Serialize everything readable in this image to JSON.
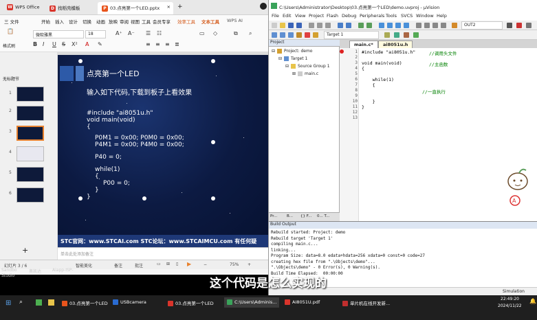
{
  "wps": {
    "tabs": [
      {
        "label": "WPS Office",
        "color": "#d9342b"
      },
      {
        "label": "找稻壳模板",
        "color": "#d9342b"
      },
      {
        "label": "03.点亮第一个LED.pptx",
        "color": "#e8541c"
      }
    ],
    "menu": [
      "三 文件",
      "开始",
      "插入",
      "设计",
      "切换",
      "动画",
      "放映",
      "审阅",
      "视图",
      "工具",
      "会员专享",
      "效率工具",
      "文本工具",
      "WPS AI"
    ],
    "font_name": "微软雅黑",
    "font_size": "18",
    "format_painter": "格式刷",
    "panel_title": "无标题节",
    "slide_numbers": [
      "1",
      "2",
      "3",
      "4",
      "5",
      "6"
    ],
    "slide": {
      "title": "点亮第一个LED",
      "subtitle": "输入如下代码,下载到板子上看效果",
      "code": [
        "#include \"ai8051u.h\"",
        "void main(void)",
        "{",
        "P0M1 = 0x00;   P0M0 = 0x00;",
        "P4M1 = 0x00;   P4M0 = 0x00;",
        "P40 = 0;",
        "while(1)",
        "{",
        "P00 = 0;",
        "}",
        "}"
      ]
    },
    "footer": "STC官网：www.STCAI.com      STC论坛：www.STCAIMCU.com      有任何疑",
    "notes_placeholder": "单击此处添加备注",
    "status_left": "幻灯片 3 / 6",
    "status_smart": "智能美化",
    "status_notes": "备注",
    "status_comment": "批注",
    "zoom": "75%"
  },
  "keil": {
    "title": "C:\\Users\\Administrator\\Desktop\\03.点亮第一个LED\\demo.uvproj - µVision",
    "menu": [
      "File",
      "Edit",
      "View",
      "Project",
      "Flash",
      "Debug",
      "Peripherals",
      "Tools",
      "SVCS",
      "Window",
      "Help"
    ],
    "target_select": "Target 1",
    "find_box": "OUT2",
    "project_title": "Project",
    "tree": [
      "Project: demo",
      "Target 1",
      "Source Group 1",
      "main.c"
    ],
    "project_tabs": [
      "Pr...",
      "B...",
      "{} F...",
      "0... T..."
    ],
    "editor_tabs": [
      "main.c*",
      "ai8051u.h"
    ],
    "line_numbers": [
      "1",
      "2",
      "3",
      "4",
      "5",
      "6",
      "7",
      "8",
      "9",
      "10",
      "11",
      "12",
      "13"
    ],
    "code_lines": [
      {
        "t": "#include \"ai8051u.h\"",
        "c": "//调用头文件"
      },
      {
        "t": "",
        "c": ""
      },
      {
        "t": "void main(void)",
        "c": "//主函数"
      },
      {
        "t": "{",
        "c": ""
      },
      {
        "t": "",
        "c": ""
      },
      {
        "t": "    while(1)",
        "c": ""
      },
      {
        "t": "    {",
        "c": ""
      },
      {
        "t": "",
        "c": "//一直执行"
      },
      {
        "t": "",
        "c": ""
      },
      {
        "t": "    }",
        "c": ""
      },
      {
        "t": "}",
        "c": ""
      },
      {
        "t": "",
        "c": ""
      },
      {
        "t": "",
        "c": ""
      }
    ],
    "build_title": "Build Output",
    "build_lines": [
      "Rebuild started: Project: demo",
      "Rebuild target 'Target 1'",
      "compiling main.c...",
      "linking...",
      "Program Size: data=8.0 edata+hdata=256 xdata=0 const=0 code=27",
      "creating hex file from \".\\Objects\\demo\"...",
      "\".\\Objects\\demo\" - 0 Error(s), 0 Warning(s).",
      "Build Time Elapsed:  00:00:00"
    ],
    "status": "Simulation"
  },
  "subtitle": "这个代码是怎么实现的",
  "taskbar": {
    "items": [
      {
        "label": "03.点亮第一个LED",
        "color": "#e8541c"
      },
      {
        "label": "USBcamera",
        "color": "#2a6bd1"
      },
      {
        "label": "03.点亮第一个LED",
        "color": "#d9342b"
      },
      {
        "label": "C:\\Users\\Adminis...",
        "color": "#3aa35a"
      },
      {
        "label": "AI8051U.pdf",
        "color": "#d9342b"
      },
      {
        "label": "单片机在线开发新...",
        "color": "#c02e2e"
      }
    ],
    "time": "22:49:20",
    "date": "2024/11/22"
  },
  "desktop_labels": [
    "Sandbo",
    "Studio",
    "奥凯达",
    "Aiapp-ISP-"
  ]
}
